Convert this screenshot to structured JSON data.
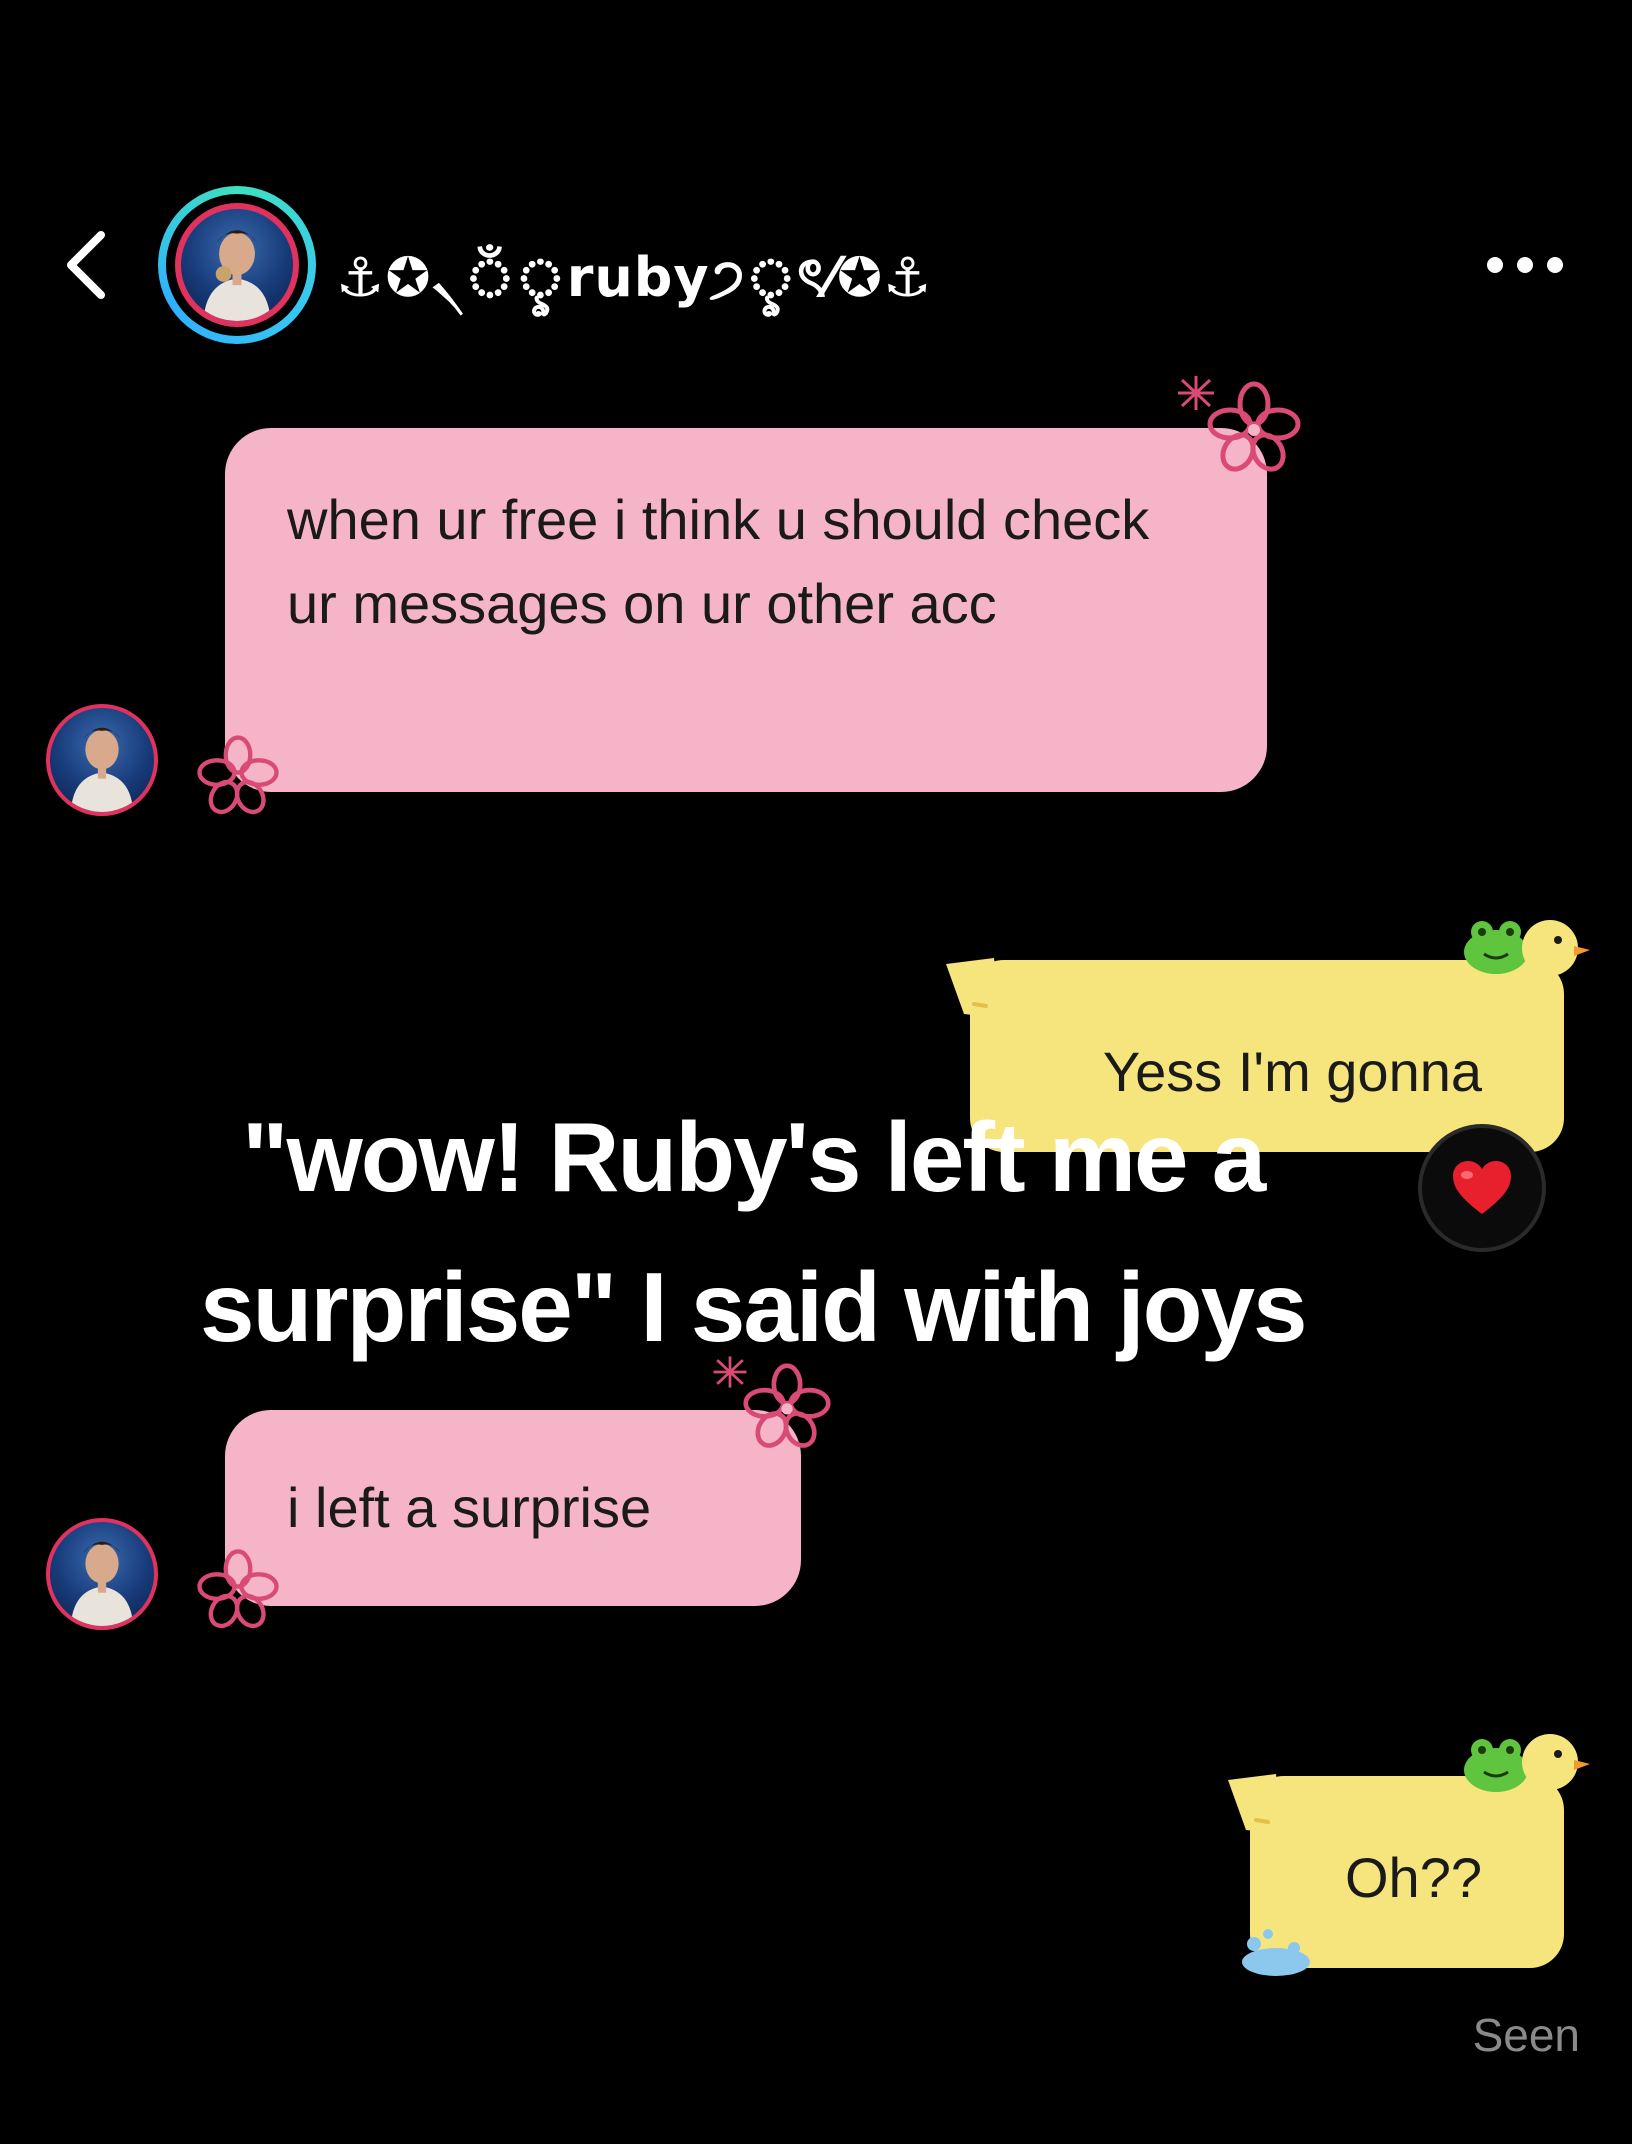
{
  "header": {
    "username": "⚓✪৲ঁৢruby੭ৢৎ⁄✪⚓",
    "back_icon": "chevron-left-icon",
    "more_icon": "more-horizontal-icon"
  },
  "messages": [
    {
      "from": "them",
      "text": "when ur free i think u should check ur messages on ur other acc"
    },
    {
      "from": "me",
      "text": "Yess I'm gonna",
      "reaction": "❤️"
    },
    {
      "from": "them",
      "text": "i left a surprise"
    },
    {
      "from": "me",
      "text": "Oh??"
    }
  ],
  "caption": {
    "line1": "\"wow! Ruby's left me a",
    "line2": "surprise\" I said with joys"
  },
  "status": {
    "seen": "Seen"
  },
  "colors": {
    "background": "#000000",
    "incoming_bubble": "#f5b4c8",
    "outgoing_bubble": "#f6e57c",
    "flower_accent": "#d94a74",
    "avatar_ring": "#3fd0e0"
  }
}
